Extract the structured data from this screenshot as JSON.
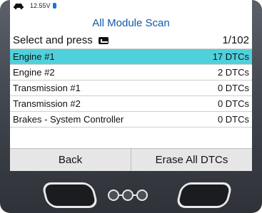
{
  "status": {
    "voltage": "12.55V",
    "icons": [
      "car-icon",
      "bluetooth-icon"
    ]
  },
  "screen": {
    "title": "All Module Scan",
    "instruction": "Select and press",
    "instruction_icon": "enter-key-icon",
    "position": "1/102"
  },
  "modules": [
    {
      "name": "Engine #1",
      "dtcs": "17 DTCs",
      "selected": true
    },
    {
      "name": "Engine #2",
      "dtcs": "2 DTCs",
      "selected": false
    },
    {
      "name": "Transmission #1",
      "dtcs": "0 DTCs",
      "selected": false
    },
    {
      "name": "Transmission #2",
      "dtcs": "0 DTCs",
      "selected": false
    },
    {
      "name": "Brakes - System Controller",
      "dtcs": "0 DTCs",
      "selected": false
    }
  ],
  "softkeys": {
    "left": "Back",
    "right": "Erase All DTCs"
  },
  "colors": {
    "title": "#0f5aa8",
    "selection": "#4fd1dc",
    "softkey_bg": "#e6e6e6",
    "bezel": "#3c4048"
  }
}
